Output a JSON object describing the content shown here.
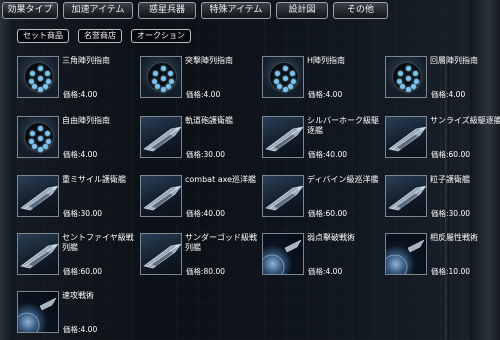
{
  "tabs": [
    {
      "label": "効果タイプ"
    },
    {
      "label": "加速アイテム"
    },
    {
      "label": "惑星兵器"
    },
    {
      "label": "特殊アイテム"
    },
    {
      "label": "設計図"
    },
    {
      "label": "その他"
    }
  ],
  "sub_buttons": [
    {
      "label": "セット商品"
    },
    {
      "label": "名誉商店"
    },
    {
      "label": "オークション"
    }
  ],
  "items": [
    {
      "name": "三角陣列指南",
      "price": "価格:4.00",
      "icon": "formation-dots-icon"
    },
    {
      "name": "突撃陣列指南",
      "price": "価格:4.00",
      "icon": "formation-dots-icon"
    },
    {
      "name": "H陣列指南",
      "price": "価格:4.00",
      "icon": "formation-dots-icon"
    },
    {
      "name": "回層陣列指南",
      "price": "価格:4.00",
      "icon": "formation-dots-icon"
    },
    {
      "name": "自由陣列指南",
      "price": "価格:4.00",
      "icon": "formation-dots-icon"
    },
    {
      "name": "軌道砲護衛艦",
      "price": "価格:30.00",
      "icon": "warship-icon"
    },
    {
      "name": "シルバーホーク級駆逐艦",
      "price": "価格:40.00",
      "icon": "warship-icon"
    },
    {
      "name": "サンライズ級駆逐艦",
      "price": "価格:60.00",
      "icon": "warship-icon"
    },
    {
      "name": "重ミサイル護衛艦",
      "price": "価格:30.00",
      "icon": "warship-icon"
    },
    {
      "name": "combat axe巡洋艦",
      "price": "価格:40.00",
      "icon": "warship-icon"
    },
    {
      "name": "ディバイン級巡洋艦",
      "price": "価格:60.00",
      "icon": "warship-icon"
    },
    {
      "name": "粒子護衛艦",
      "price": "価格:30.00",
      "icon": "warship-icon"
    },
    {
      "name": "セントファイヤ級戦列艦",
      "price": "価格:60.00",
      "icon": "warship-icon"
    },
    {
      "name": "サンダーゴッド級戦列艦",
      "price": "価格:80.00",
      "icon": "warship-icon"
    },
    {
      "name": "弱点擊破戦術",
      "price": "価格:4.00",
      "icon": "planet-tactic-icon"
    },
    {
      "name": "相反屬性戦術",
      "price": "価格:10.00",
      "icon": "planet-tactic-icon"
    },
    {
      "name": "速攻戦術",
      "price": "価格:4.00",
      "icon": "planet-tactic-icon"
    }
  ]
}
